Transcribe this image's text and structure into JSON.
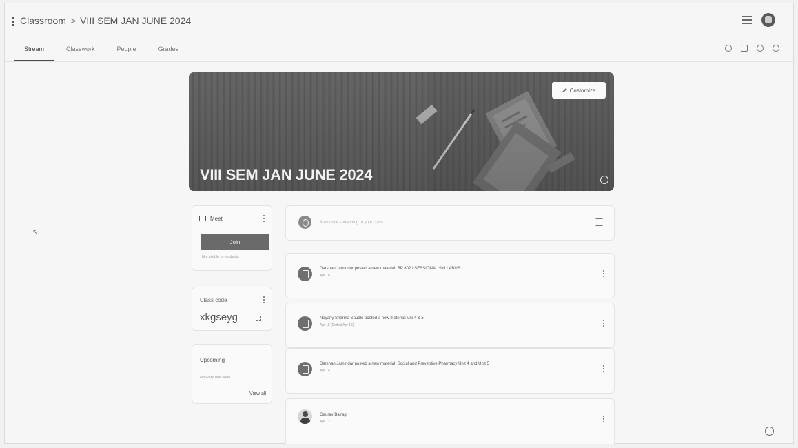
{
  "header": {
    "breadcrumb_root": "Classroom",
    "breadcrumb_separator": ">",
    "breadcrumb_current": "VIII SEM JAN JUNE 2024"
  },
  "tabs": [
    {
      "label": "Stream",
      "active": true
    },
    {
      "label": "Classwork",
      "active": false
    },
    {
      "label": "People",
      "active": false
    },
    {
      "label": "Grades",
      "active": false
    }
  ],
  "banner": {
    "title": "VIII SEM JAN JUNE 2024",
    "customize_label": "Customize"
  },
  "meet": {
    "label": "Meet",
    "join_label": "Join",
    "note": "Not visible to students"
  },
  "class_code": {
    "label": "Class code",
    "value": "xkgseyg"
  },
  "upcoming": {
    "title": "Upcoming",
    "subtitle": "No work due soon",
    "view_all": "View all"
  },
  "announce": {
    "placeholder": "Announce something to your class"
  },
  "posts": [
    {
      "title": "Darshan Jamindar posted a new material: BP 802 I SESSIONAL SYLLABUS",
      "date": "Apr 16"
    },
    {
      "title": "Nayany Sharma Saudle posted a new material: uni 4 & 5",
      "date": "Apr 15 (Edited Apr 16)"
    },
    {
      "title": "Darshan Jamindar posted a new material: Social and Preventive Pharmacy Unit 4 and Unit 5",
      "date": "Apr 14"
    }
  ],
  "person_post": {
    "name": "Gaurav Bairagi",
    "date": "Apr 12"
  },
  "icons": {
    "top_menu": "menu-icon",
    "apps": "apps-icon",
    "account": "avatar-icon",
    "help": "help-icon"
  },
  "colors": {
    "banner": "#6b6b6b",
    "join_button": "#6a6a6a",
    "background": "#f6f6f6"
  }
}
